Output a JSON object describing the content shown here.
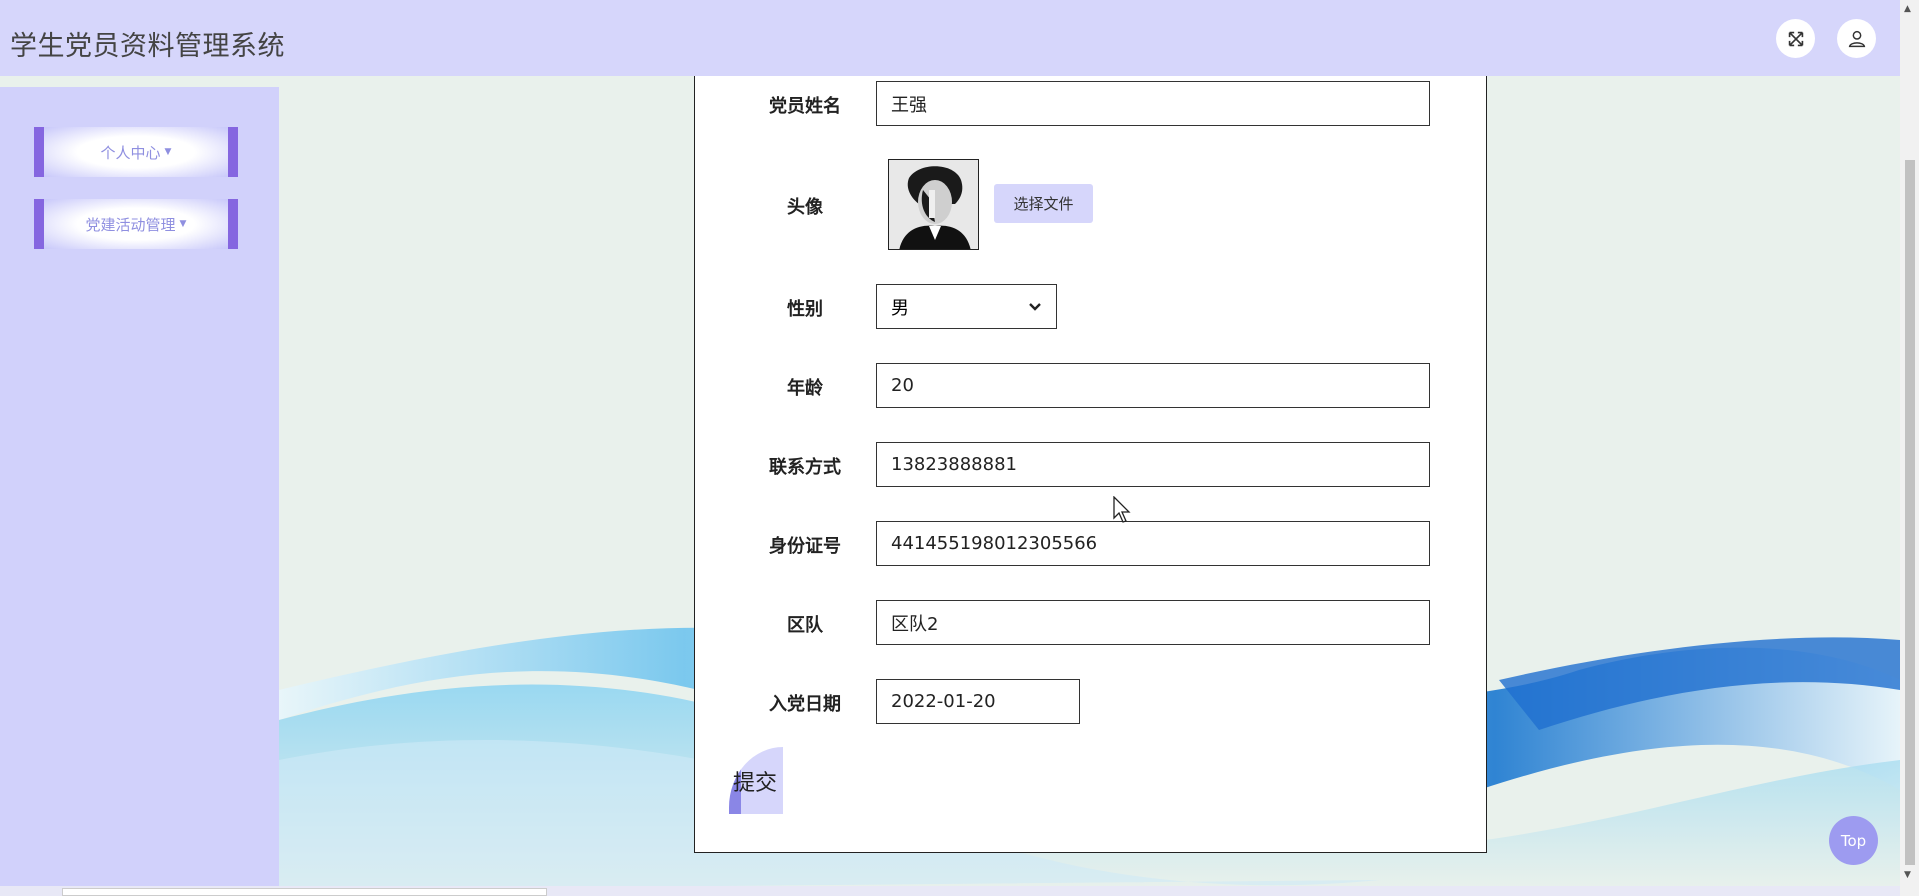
{
  "header": {
    "title": "学生党员资料管理系统",
    "fullscreen_icon": "fullscreen-icon",
    "user_icon": "user-icon"
  },
  "sidebar": {
    "items": [
      {
        "label": "个人中心"
      },
      {
        "label": "党建活动管理"
      }
    ]
  },
  "form": {
    "fields": {
      "name": {
        "label": "党员姓名",
        "value": "王强"
      },
      "avatar": {
        "label": "头像",
        "upload_label": "选择文件"
      },
      "gender": {
        "label": "性别",
        "value": "男"
      },
      "age": {
        "label": "年龄",
        "value": "20"
      },
      "contact": {
        "label": "联系方式",
        "value": "13823888881"
      },
      "id_number": {
        "label": "身份证号",
        "value": "441455198012305566"
      },
      "team": {
        "label": "区队",
        "value": "区队2"
      },
      "join_date": {
        "label": "入党日期",
        "value": "2022-01-20"
      }
    },
    "submit_label": "提交"
  },
  "back_to_top": {
    "label": "Top"
  },
  "colors": {
    "header_bg": "#d6d6fb",
    "sidebar_bg": "#d1d1fb",
    "menu_accent": "#8566e0",
    "top_button": "#9d9bf0"
  }
}
